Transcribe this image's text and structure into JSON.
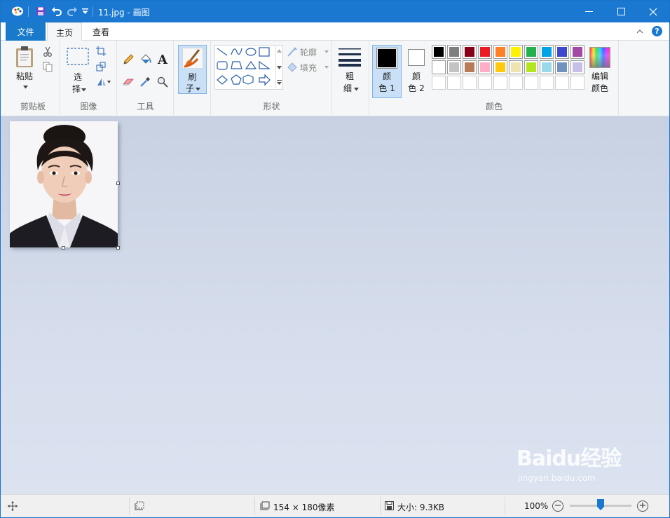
{
  "window": {
    "title": "11.jpg - 画图",
    "accent": "#1a78d0"
  },
  "menu": {
    "file": "文件",
    "home": "主页",
    "view": "查看"
  },
  "clipboard": {
    "paste": "粘贴",
    "group": "剪贴板"
  },
  "image_group": {
    "select_line1": "选",
    "select_line2": "择",
    "group": "图像"
  },
  "tools": {
    "text_glyph": "A",
    "group": "工具"
  },
  "brushes": {
    "line1": "刷",
    "line2": "子"
  },
  "shapes": {
    "outline": "轮廓",
    "fill": "填充",
    "group": "形状"
  },
  "size": {
    "line1": "粗",
    "line2": "细"
  },
  "colors": {
    "color1_line1": "颜",
    "color1_line2": "色 1",
    "color2_line1": "颜",
    "color2_line2": "色 2",
    "edit_line1": "编辑",
    "edit_line2": "颜色",
    "group": "颜色",
    "color1": "#000000",
    "color2": "#ffffff",
    "palette_row1": [
      "#000000",
      "#7f7f7f",
      "#880015",
      "#ed1c24",
      "#ff7f27",
      "#fff200",
      "#22b14c",
      "#00a2e8",
      "#3f48cc",
      "#a349a4"
    ],
    "palette_row2": [
      "#ffffff",
      "#c3c3c3",
      "#b97a57",
      "#ffaec9",
      "#ffc90e",
      "#efe4b0",
      "#b5e61d",
      "#99d9ea",
      "#7092be",
      "#c8bfe7"
    ]
  },
  "status": {
    "dimensions": "154 × 180像素",
    "size": "大小: 9.3KB",
    "zoom": "100%",
    "zoom_level": 0.5
  },
  "watermark": {
    "text": "Baidu经验",
    "url": "jingyan.baidu.com"
  }
}
